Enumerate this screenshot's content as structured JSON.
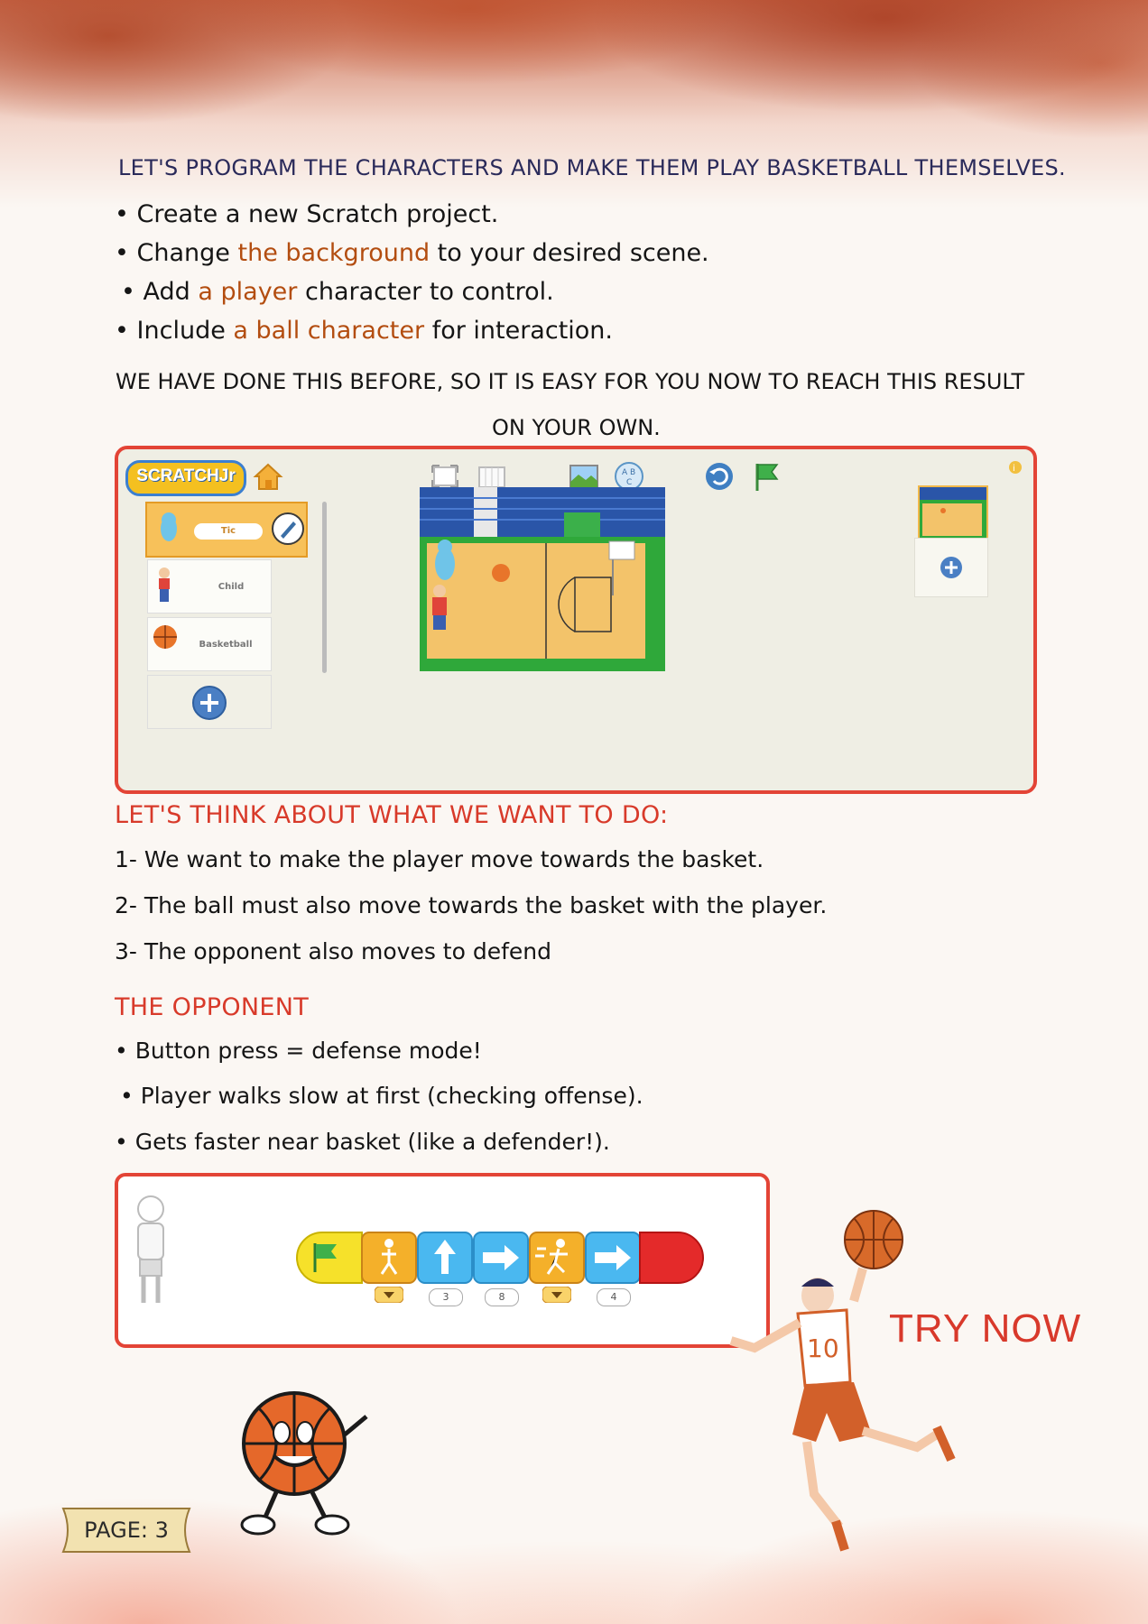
{
  "intro_heading": "LET'S PROGRAM THE CHARACTERS AND MAKE THEM PLAY BASKETBALL THEMSELVES.",
  "setup_bullets": [
    {
      "pre": "Create a new Scratch project.",
      "accent": "",
      "post": ""
    },
    {
      "pre": "Change ",
      "accent": "the background",
      "post": " to your desired scene."
    },
    {
      "pre": "Add ",
      "accent": "a player",
      "post": " character to control."
    },
    {
      "pre": "Include ",
      "accent": "a ball character",
      "post": " for interaction."
    }
  ],
  "done_before_line1": "WE HAVE DONE THIS BEFORE, SO IT IS EASY FOR YOU NOW TO REACH THIS RESULT",
  "done_before_line2": "ON YOUR OWN.",
  "scratchjr": {
    "logo_text": "SCRATCHJr",
    "sprites": [
      "Tic",
      "Child",
      "Basketball"
    ]
  },
  "think_heading": "LET'S THINK ABOUT WHAT WE WANT TO DO:",
  "steps": [
    "1- We want to make the player move towards the basket.",
    "2- The ball must also move towards the basket with the player.",
    "3- The opponent also moves to defend"
  ],
  "opponent_heading": "THE OPPONENT",
  "opponent_bullets": [
    "Button press = defense mode!",
    "Player walks slow at first (checking offense).",
    "Gets faster near basket (like a defender!)."
  ],
  "code_block_values": [
    "3",
    "8",
    "4"
  ],
  "try_now": "TRY NOW",
  "page_label": "PAGE: 3",
  "colors": {
    "accent_orange": "#b34d10",
    "heading_red": "#d83a2a",
    "frame_red": "#e34436"
  }
}
